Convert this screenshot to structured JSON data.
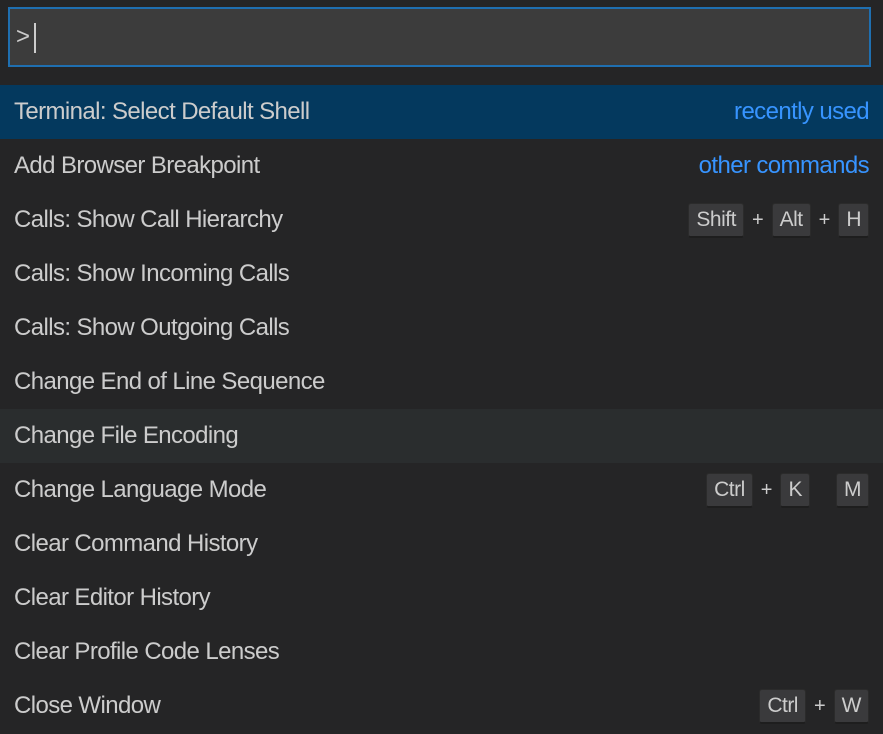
{
  "input": {
    "value": ">"
  },
  "commands": [
    {
      "label": "Terminal: Select Default Shell",
      "group": "recently used"
    },
    {
      "label": "Add Browser Breakpoint",
      "group": "other commands"
    },
    {
      "label": "Calls: Show Call Hierarchy",
      "keys": [
        "Shift",
        "Alt",
        "H"
      ]
    },
    {
      "label": "Calls: Show Incoming Calls"
    },
    {
      "label": "Calls: Show Outgoing Calls"
    },
    {
      "label": "Change End of Line Sequence"
    },
    {
      "label": "Change File Encoding"
    },
    {
      "label": "Change Language Mode",
      "keys": [
        "Ctrl",
        "K"
      ],
      "chord": [
        "M"
      ]
    },
    {
      "label": "Clear Command History"
    },
    {
      "label": "Clear Editor History"
    },
    {
      "label": "Clear Profile Code Lenses"
    },
    {
      "label": "Close Window",
      "keys": [
        "Ctrl",
        "W"
      ]
    }
  ],
  "plus_symbol": "+",
  "colors": {
    "selected_row": "#04395e",
    "hovered_row": "#2a2d2e",
    "group_label": "#3794ff",
    "input_border": "#1f6fb0"
  }
}
